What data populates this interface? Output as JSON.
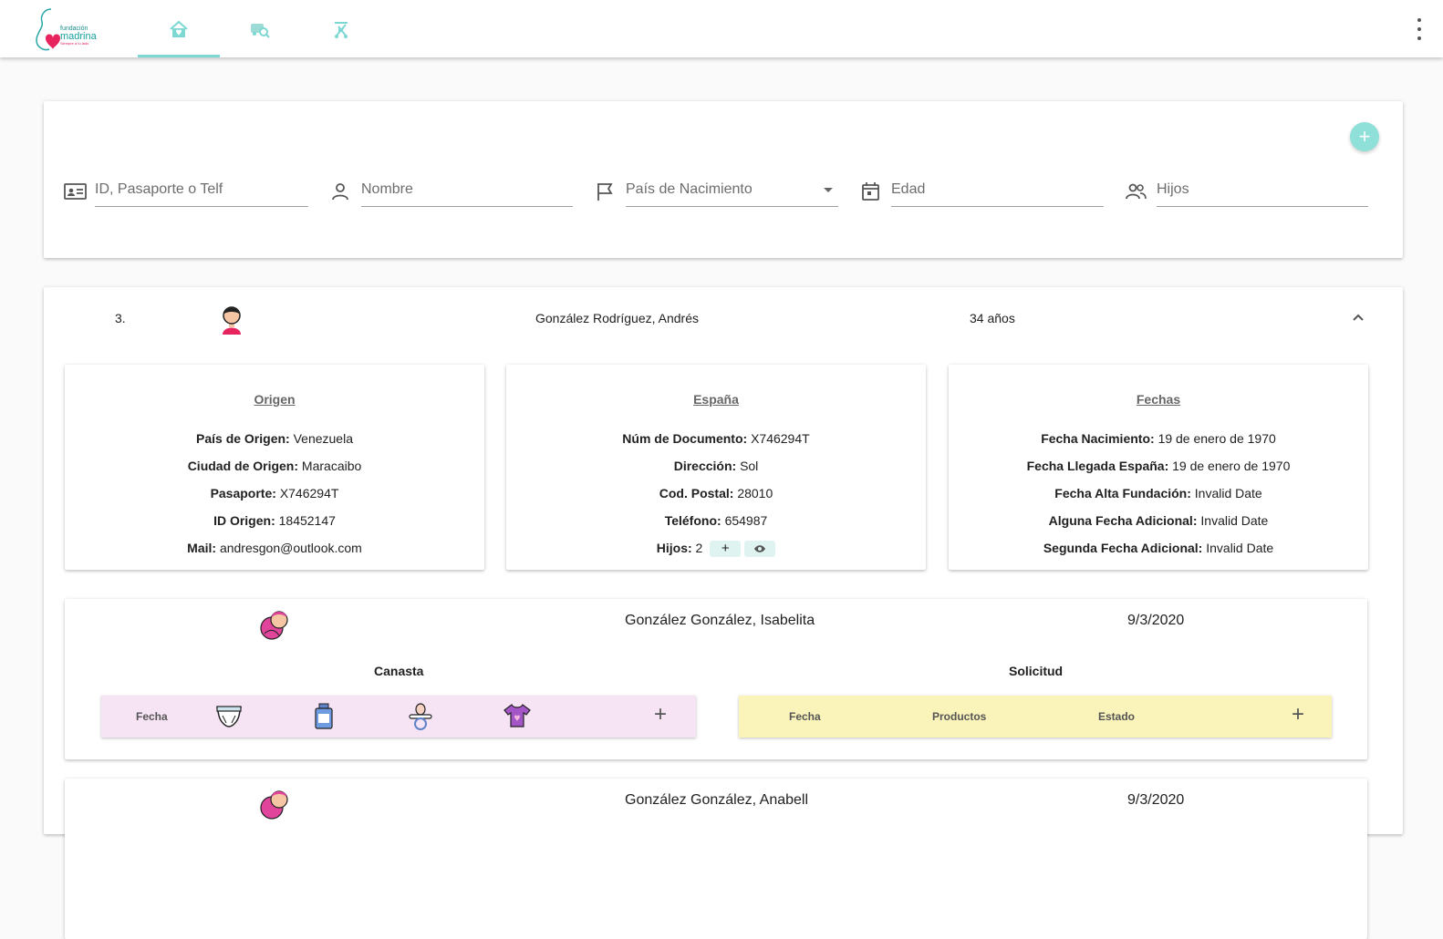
{
  "app": {
    "logo_text": [
      "fundación",
      "madrina",
      "Siempre a tu lado"
    ],
    "nav_tabs": [
      {
        "icon": "home-heart-icon",
        "active": true
      },
      {
        "icon": "search-van-icon",
        "active": false
      },
      {
        "icon": "stroller-icon",
        "active": false
      }
    ],
    "menu_icon": "more-vert-icon",
    "accent_color": "#7dd8d3"
  },
  "search": {
    "add_label": "+",
    "fields": {
      "id": "ID, Pasaporte o Telf",
      "name": "Nombre",
      "country": "País de Nacimiento",
      "age": "Edad",
      "children": "Hijos"
    }
  },
  "person": {
    "index": "3.",
    "name": "González Rodríguez, Andrés",
    "age": "34 años",
    "origin": {
      "title": "Origen",
      "country_label": "País de Origen:",
      "country": "Venezuela",
      "city_label": "Ciudad de Origen:",
      "city": "Maracaibo",
      "passport_label": "Pasaporte:",
      "passport": "X746294T",
      "id_label": "ID Origen:",
      "id": "18452147",
      "mail_label": "Mail:",
      "mail": "andresgon@outlook.com"
    },
    "spain": {
      "title": "España",
      "doc_label": "Núm de Documento:",
      "doc": "X746294T",
      "address_label": "Dirección:",
      "address": "Sol",
      "postal_label": "Cod. Postal:",
      "postal": "28010",
      "phone_label": "Teléfono:",
      "phone": "654987",
      "children_label": "Hijos:",
      "children": "2",
      "add_child": "+"
    },
    "dates": {
      "title": "Fechas",
      "birth_label": "Fecha Nacimiento:",
      "birth": "19 de enero de 1970",
      "arrival_label": "Fecha Llegada España:",
      "arrival": "19 de enero de 1970",
      "signup_label": "Fecha Alta Fundación:",
      "signup": "Invalid Date",
      "extra1_label": "Alguna Fecha Adicional:",
      "extra1": "Invalid Date",
      "extra2_label": "Segunda Fecha Adicional:",
      "extra2": "Invalid Date"
    }
  },
  "children": [
    {
      "name": "González González, Isabelita",
      "date": "9/3/2020",
      "canasta_title": "Canasta",
      "solicitud_title": "Solicitud",
      "canasta_headers": {
        "fecha": "Fecha",
        "icons": [
          "diaper-icon",
          "milk-bottle-icon",
          "pacifier-icon",
          "onesie-icon"
        ]
      },
      "solicitud_headers": {
        "fecha": "Fecha",
        "productos": "Productos",
        "estado": "Estado"
      },
      "add": "+"
    },
    {
      "name": "González González, Anabell",
      "date": "9/3/2020"
    }
  ]
}
